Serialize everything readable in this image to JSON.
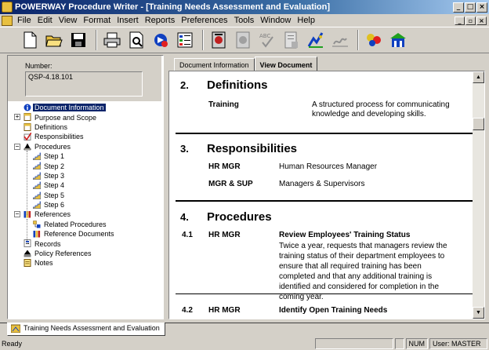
{
  "window": {
    "title": "POWERWAY Procedure Writer - [Training Needs Assessment and Evaluation]"
  },
  "menu": {
    "items": [
      "File",
      "Edit",
      "View",
      "Format",
      "Insert",
      "Reports",
      "Preferences",
      "Tools",
      "Window",
      "Help"
    ]
  },
  "toolbar": {
    "icons": [
      "new-document-icon",
      "open-folder-icon",
      "save-icon",
      "print-icon",
      "print-preview-icon",
      "refresh-icon",
      "outline-icon",
      "approve-icon",
      "archive-icon",
      "spellcheck-icon",
      "report-icon",
      "chart-icon",
      "signature-icon",
      "team-icon",
      "building-icon"
    ]
  },
  "left": {
    "number_label": "Number:",
    "number_value": "QSP-4.18.101",
    "tree": [
      {
        "label": "Document Information",
        "level": 0,
        "selected": true,
        "expander": "",
        "icon": "info-icon"
      },
      {
        "label": "Purpose and Scope",
        "level": 0,
        "selected": false,
        "expander": "+",
        "icon": "page-icon"
      },
      {
        "label": "Definitions",
        "level": 0,
        "selected": false,
        "expander": "",
        "icon": "page-icon"
      },
      {
        "label": "Responsibilities",
        "level": 0,
        "selected": false,
        "expander": "",
        "icon": "checkmark-icon"
      },
      {
        "label": "Procedures",
        "level": 0,
        "selected": false,
        "expander": "−",
        "icon": "procedures-icon"
      },
      {
        "label": "Step 1",
        "level": 1,
        "selected": false,
        "expander": "",
        "icon": "stairs-icon"
      },
      {
        "label": "Step 2",
        "level": 1,
        "selected": false,
        "expander": "",
        "icon": "stairs-icon"
      },
      {
        "label": "Step 3",
        "level": 1,
        "selected": false,
        "expander": "",
        "icon": "stairs-icon"
      },
      {
        "label": "Step 4",
        "level": 1,
        "selected": false,
        "expander": "",
        "icon": "stairs-icon"
      },
      {
        "label": "Step 5",
        "level": 1,
        "selected": false,
        "expander": "",
        "icon": "stairs-icon"
      },
      {
        "label": "Step 6",
        "level": 1,
        "selected": false,
        "expander": "",
        "icon": "stairs-icon"
      },
      {
        "label": "References",
        "level": 0,
        "selected": false,
        "expander": "−",
        "icon": "books-icon"
      },
      {
        "label": "Related Procedures",
        "level": 1,
        "selected": false,
        "expander": "",
        "icon": "related-icon"
      },
      {
        "label": "Reference Documents",
        "level": 1,
        "selected": false,
        "expander": "",
        "icon": "books-icon"
      },
      {
        "label": "Records",
        "level": 0,
        "selected": false,
        "expander": "",
        "icon": "records-icon"
      },
      {
        "label": "Policy References",
        "level": 0,
        "selected": false,
        "expander": "",
        "icon": "policy-icon"
      },
      {
        "label": "Notes",
        "level": 0,
        "selected": false,
        "expander": "",
        "icon": "notes-icon"
      }
    ]
  },
  "tabs": {
    "doc_info": "Document Information",
    "view_doc": "View Document"
  },
  "document": {
    "s2_num": "2.",
    "s2_title": "Definitions",
    "s2_term": "Training",
    "s2_def_line1": "A structured process for communicating",
    "s2_def_line2": "knowledge and developing skills.",
    "s3_num": "3.",
    "s3_title": "Responsibilities",
    "s3_role1": "HR MGR",
    "s3_desc1": "Human Resources Manager",
    "s3_role2": "MGR & SUP",
    "s3_desc2": "Managers & Supervisors",
    "s4_num": "4.",
    "s4_title": "Procedures",
    "p1_num": "4.1",
    "p1_role": "HR MGR",
    "p1_title": "Review Employees' Training Status",
    "p1_body": "Twice a year, requests that managers review the training status of their department employees to ensure that all required training has been completed and that any additional training is identified and considered for completion in the coming year.",
    "p2_num": "4.2",
    "p2_role": "HR MGR",
    "p2_title": "Identify Open Training Needs"
  },
  "bottom_tab": {
    "label": "Training Needs Assessment and Evaluation"
  },
  "status": {
    "text": "Ready",
    "num": "NUM",
    "user": "User: MASTER"
  }
}
